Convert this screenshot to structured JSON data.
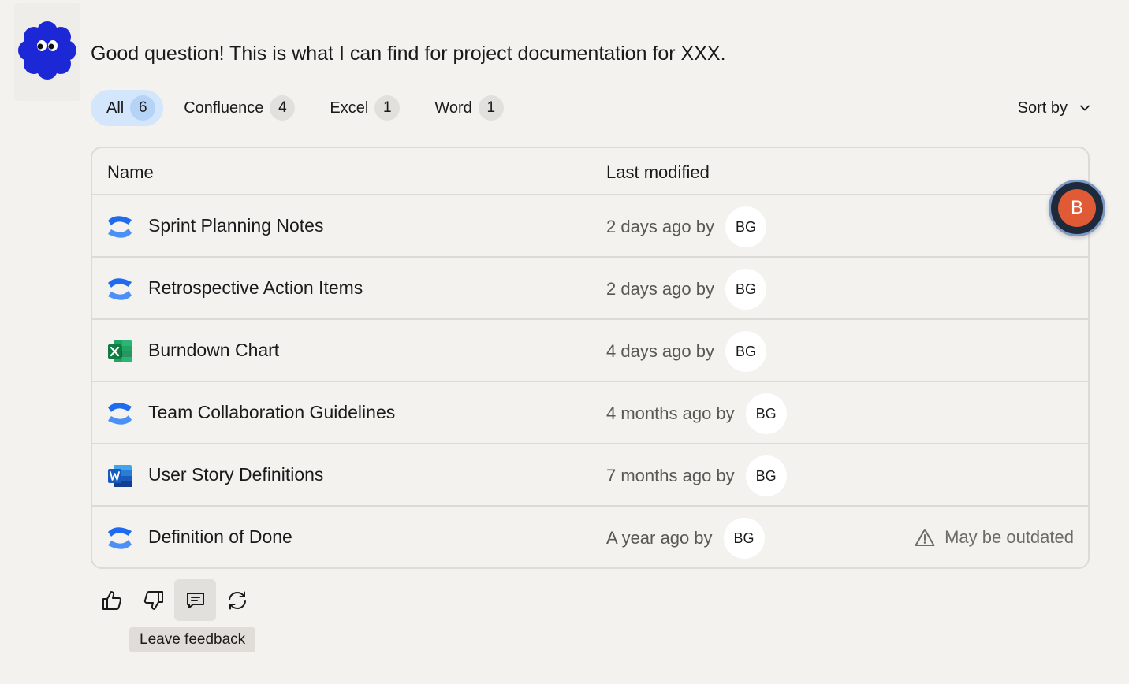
{
  "assistant": {
    "avatar_icon": "flower-mascot-icon",
    "message": "Good question! This is what I can find for project documentation for XXX."
  },
  "filters": [
    {
      "label": "All",
      "count": "6",
      "active": true
    },
    {
      "label": "Confluence",
      "count": "4",
      "active": false
    },
    {
      "label": "Excel",
      "count": "1",
      "active": false
    },
    {
      "label": "Word",
      "count": "1",
      "active": false
    }
  ],
  "sort": {
    "label": "Sort by",
    "icon": "chevron-down-icon"
  },
  "table": {
    "headers": {
      "name": "Name",
      "modified": "Last modified"
    },
    "rows": [
      {
        "name": "Sprint Planning Notes",
        "type": "confluence",
        "modified": "2 days ago by",
        "user": "BG",
        "warning": ""
      },
      {
        "name": "Retrospective Action Items",
        "type": "confluence",
        "modified": "2 days ago by",
        "user": "BG",
        "warning": ""
      },
      {
        "name": "Burndown Chart",
        "type": "excel",
        "modified": "4 days ago by",
        "user": "BG",
        "warning": ""
      },
      {
        "name": "Team Collaboration Guidelines",
        "type": "confluence",
        "modified": "4 months ago by",
        "user": "BG",
        "warning": ""
      },
      {
        "name": "User Story Definitions",
        "type": "word",
        "modified": "7 months ago by",
        "user": "BG",
        "warning": ""
      },
      {
        "name": "Definition of Done",
        "type": "confluence",
        "modified": "A year ago by",
        "user": "BG",
        "warning": "May be outdated"
      }
    ]
  },
  "floating_user": {
    "initial": "B"
  },
  "actions": {
    "items": [
      "thumbs-up-icon",
      "thumbs-down-icon",
      "feedback-icon",
      "regenerate-icon"
    ],
    "tooltip": "Leave feedback"
  },
  "colors": {
    "background": "#f3f2ef",
    "mascot": "#1c28d6",
    "chip_active": "#d3e6fb",
    "confluence": "#1f6bf0",
    "excel": "#1d7044",
    "word": "#185abd",
    "user_bubble": "#e05a36"
  }
}
